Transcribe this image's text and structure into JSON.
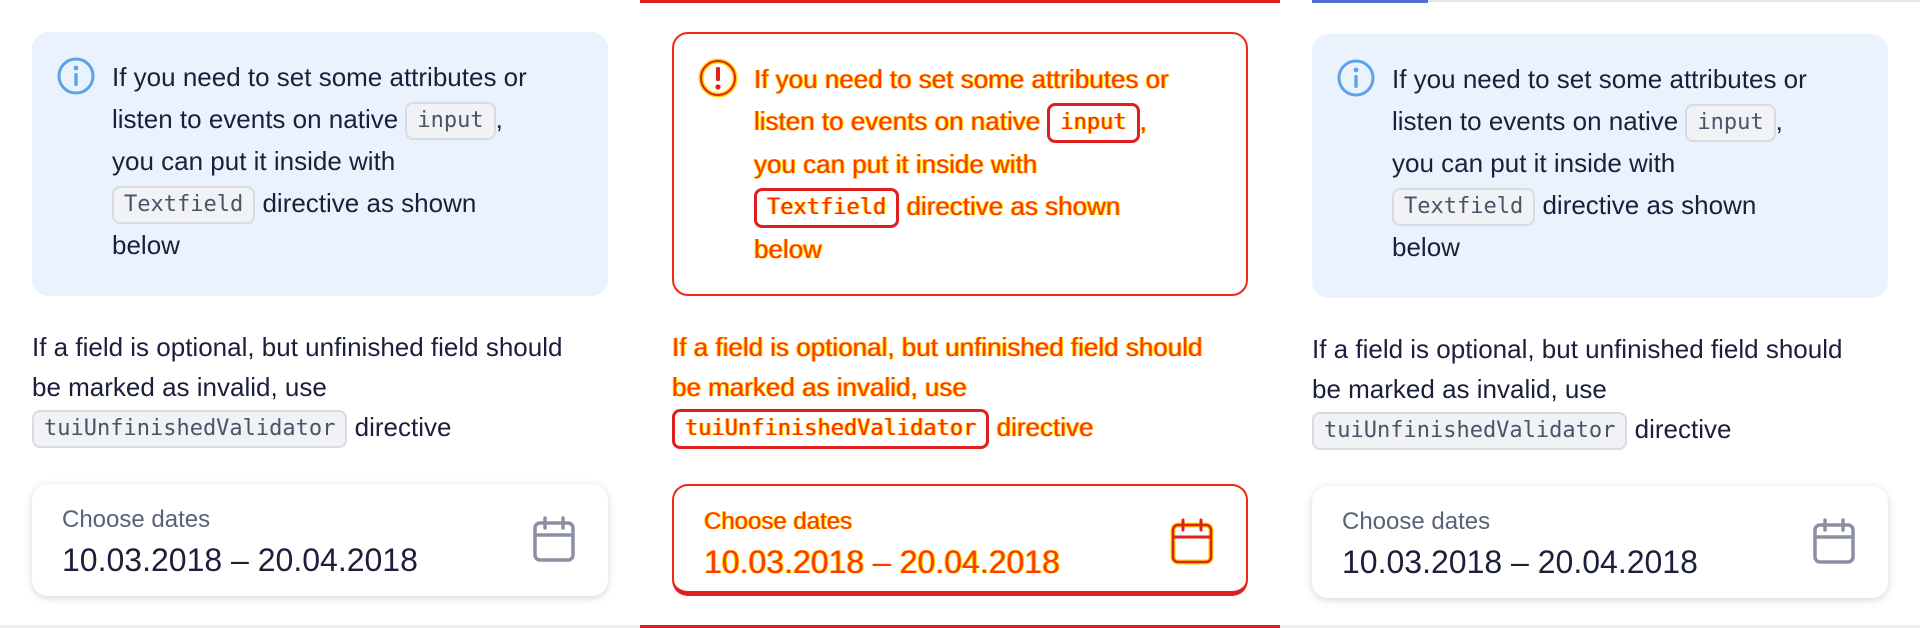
{
  "notification": {
    "line1": "If you need to set some attributes or",
    "line2_pre": "listen to events on native",
    "line2_code": "input",
    "line2_post": ",",
    "line3": "you can put it inside with",
    "line4_code": "Textfield",
    "line4_post": "directive as shown",
    "line5": "below"
  },
  "paragraph": {
    "line1": "If a field is optional, but unfinished field should",
    "line2": "be marked as invalid, use",
    "code": "tuiUnfinishedValidator",
    "post": "directive"
  },
  "date_field": {
    "label": "Choose dates",
    "value": "10.03.2018 – 20.04.2018"
  },
  "icons": {
    "notification": "info-circle-icon",
    "date_field": "calendar-icon"
  },
  "colors": {
    "notification_bg": "#eaf3fd",
    "info_icon": "#5da3eb",
    "diff_red": "#e01f1f",
    "diff_yellow": "#ffd400",
    "tab_accent": "#526ed3"
  }
}
